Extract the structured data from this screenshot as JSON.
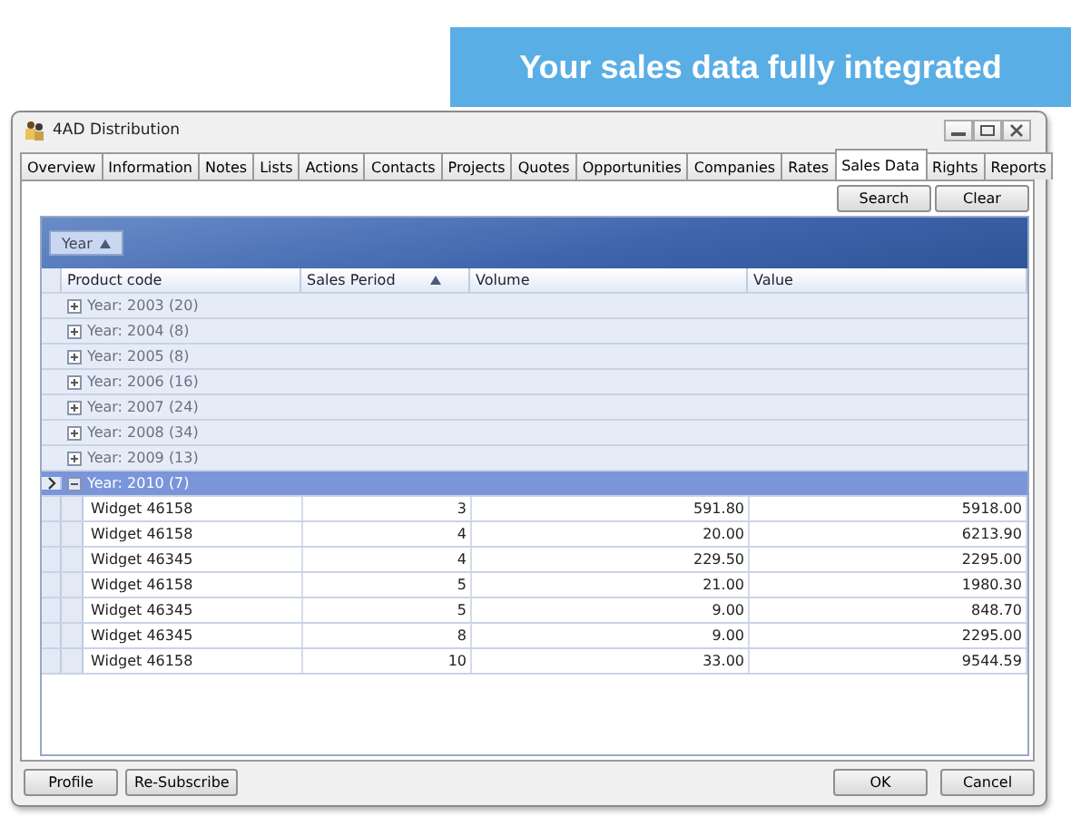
{
  "banner": {
    "text": "Your sales data fully integrated"
  },
  "window": {
    "title": "4AD Distribution"
  },
  "tabs": [
    {
      "label": "Overview",
      "selected": false
    },
    {
      "label": "Information",
      "selected": false
    },
    {
      "label": "Notes",
      "selected": false
    },
    {
      "label": "Lists",
      "selected": false
    },
    {
      "label": "Actions",
      "selected": false
    },
    {
      "label": "Contacts",
      "selected": false
    },
    {
      "label": "Projects",
      "selected": false
    },
    {
      "label": "Quotes",
      "selected": false
    },
    {
      "label": "Opportunities",
      "selected": false
    },
    {
      "label": "Companies",
      "selected": false
    },
    {
      "label": "Rates",
      "selected": false
    },
    {
      "label": "Sales Data",
      "selected": true
    },
    {
      "label": "Rights",
      "selected": false
    },
    {
      "label": "Reports",
      "selected": false
    }
  ],
  "toolbar": {
    "buttons": [
      "Search",
      "Clear"
    ]
  },
  "group_panel": {
    "chip": {
      "label": "Year",
      "sorted": true
    }
  },
  "table": {
    "columns": [
      {
        "label": "Product code",
        "sorted": false
      },
      {
        "label": "Sales Period",
        "sorted": true
      },
      {
        "label": "Volume",
        "sorted": false
      },
      {
        "label": "Value",
        "sorted": false
      }
    ],
    "groups": [
      {
        "label": "Year: 2003 (20)",
        "expanded": false,
        "selected": false
      },
      {
        "label": "Year: 2004 (8)",
        "expanded": false,
        "selected": false
      },
      {
        "label": "Year: 2005 (8)",
        "expanded": false,
        "selected": false
      },
      {
        "label": "Year: 2006 (16)",
        "expanded": false,
        "selected": false
      },
      {
        "label": "Year: 2007 (24)",
        "expanded": false,
        "selected": false
      },
      {
        "label": "Year: 2008 (34)",
        "expanded": false,
        "selected": false
      },
      {
        "label": "Year: 2009 (13)",
        "expanded": false,
        "selected": false
      },
      {
        "label": "Year: 2010 (7)",
        "expanded": true,
        "selected": true,
        "rows": [
          [
            "Widget 46158",
            "3",
            "591.80",
            "5918.00"
          ],
          [
            "Widget 46158",
            "4",
            "20.00",
            "6213.90"
          ],
          [
            "Widget 46345",
            "4",
            "229.50",
            "2295.00"
          ],
          [
            "Widget 46158",
            "5",
            "21.00",
            "1980.30"
          ],
          [
            "Widget 46345",
            "5",
            "9.00",
            "848.70"
          ],
          [
            "Widget 46345",
            "8",
            "9.00",
            "2295.00"
          ],
          [
            "Widget 46158",
            "10",
            "33.00",
            "9544.59"
          ]
        ]
      }
    ]
  },
  "footer": {
    "left_buttons": [
      "Profile",
      "Re-Subscribe"
    ],
    "right_buttons": [
      "OK",
      "Cancel"
    ]
  }
}
